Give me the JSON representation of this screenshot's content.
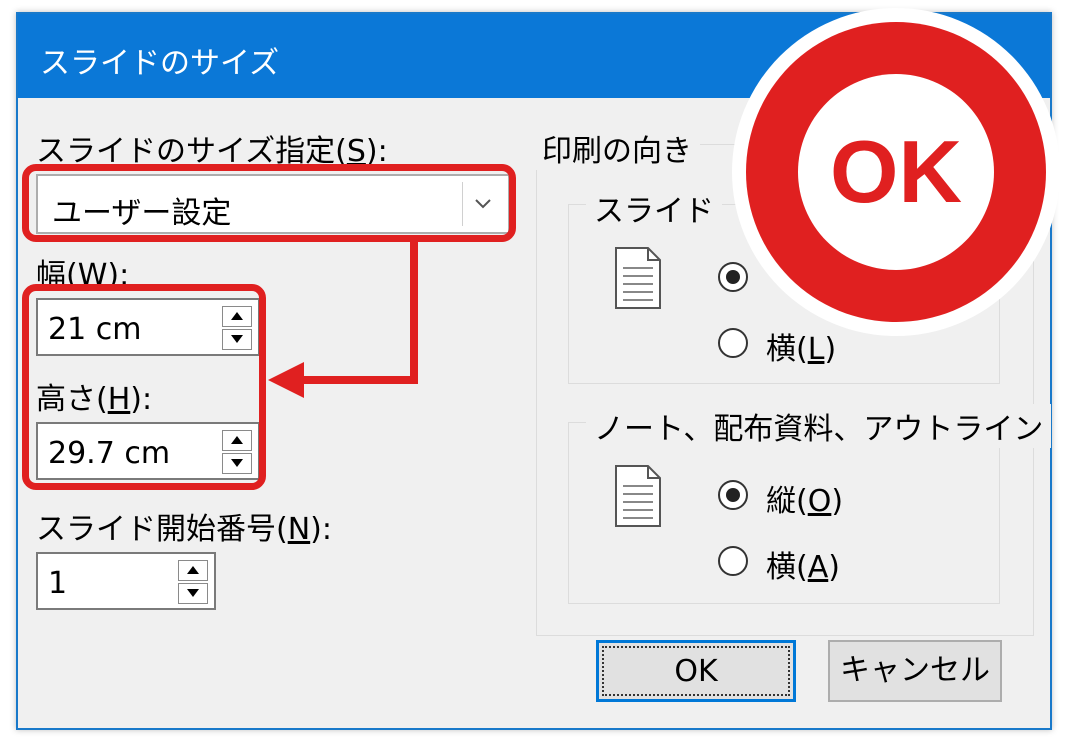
{
  "dialog": {
    "title": "スライドのサイズ",
    "size_label_prefix": "スライドのサイズ指定(",
    "size_label_key": "S",
    "size_label_suffix": "):",
    "size_value": "ユーザー設定",
    "width_label_prefix": "幅(",
    "width_label_key": "W",
    "width_label_suffix": "):",
    "width_value": "21 cm",
    "height_label_prefix": "高さ(",
    "height_label_key": "H",
    "height_label_suffix": "):",
    "height_value": "29.7 cm",
    "start_label_prefix": "スライド開始番号(",
    "start_label_key": "N",
    "start_label_suffix": "):",
    "start_value": "1",
    "orientation_title": "印刷の向き",
    "slides_group": {
      "title": "スライド",
      "landscape_prefix": "横(",
      "landscape_key": "L",
      "landscape_suffix": ")",
      "selected": "portrait"
    },
    "notes_group": {
      "title": "ノート、配布資料、アウトライン",
      "portrait_prefix": "縦(",
      "portrait_key": "O",
      "portrait_suffix": ")",
      "landscape_prefix": "横(",
      "landscape_key": "A",
      "landscape_suffix": ")",
      "selected": "portrait"
    },
    "ok_button": "OK",
    "cancel_button": "キャンセル"
  },
  "overlay": {
    "badge_text": "OK",
    "badge_color": "#e02020",
    "highlight_color": "#e02020"
  },
  "colors": {
    "titlebar": "#0b78d7",
    "dialog_bg": "#f0f0f0"
  }
}
